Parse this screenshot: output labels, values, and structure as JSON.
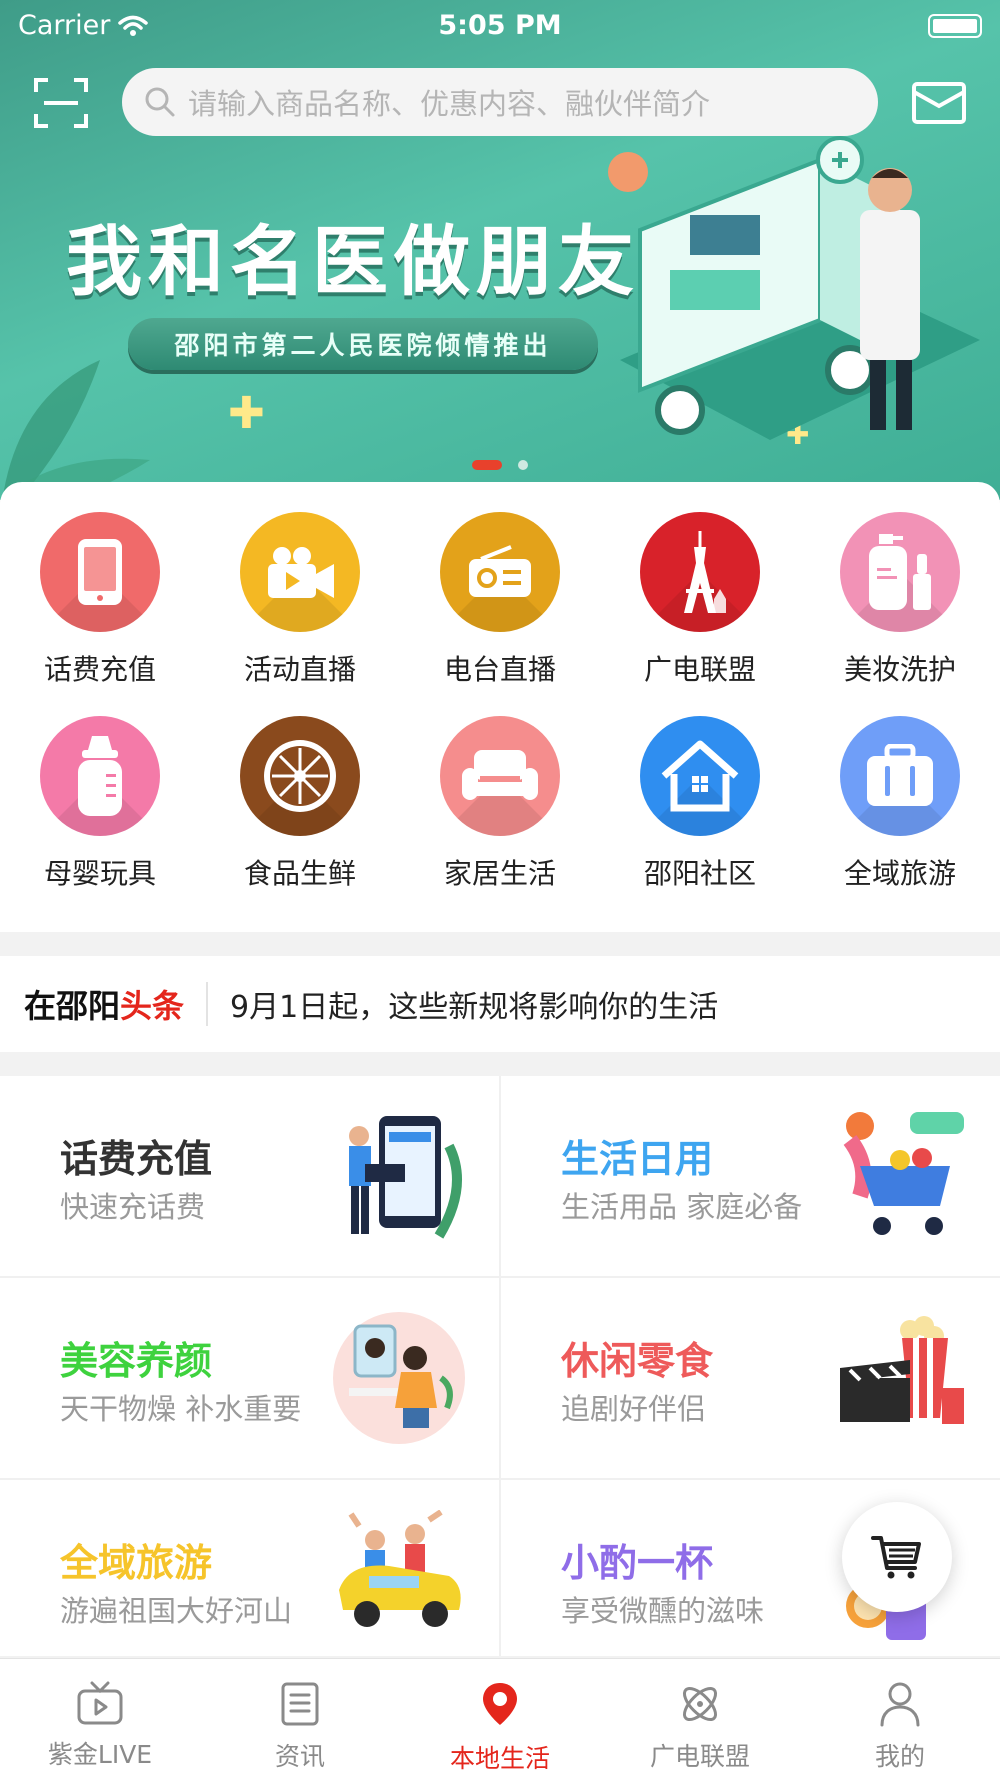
{
  "status_bar": {
    "carrier": "Carrier",
    "time": "5:05 PM"
  },
  "search": {
    "placeholder": "请输入商品名称、优惠内容、融伙伴简介"
  },
  "banner": {
    "title": "我和名医做朋友",
    "subtitle": "邵阳市第二人民医院倾情推出",
    "page_count": 2,
    "active_page": 1
  },
  "categories": [
    {
      "label": "话费充值",
      "icon": "phone-icon",
      "color": "#f06a6a"
    },
    {
      "label": "活动直播",
      "icon": "video-camera-icon",
      "color": "#f4b823"
    },
    {
      "label": "电台直播",
      "icon": "radio-icon",
      "color": "#e3a21a"
    },
    {
      "label": "广电联盟",
      "icon": "tower-icon",
      "color": "#d8222a"
    },
    {
      "label": "美妆洗护",
      "icon": "cosmetics-icon",
      "color": "#f292b6"
    },
    {
      "label": "母婴玩具",
      "icon": "baby-bottle-icon",
      "color": "#f47aa8"
    },
    {
      "label": "食品生鲜",
      "icon": "orange-slice-icon",
      "color": "#8a4a1d"
    },
    {
      "label": "家居生活",
      "icon": "sofa-icon",
      "color": "#f58d8d"
    },
    {
      "label": "邵阳社区",
      "icon": "house-icon",
      "color": "#2f8ef0"
    },
    {
      "label": "全域旅游",
      "icon": "suitcase-icon",
      "color": "#6f9ef8"
    }
  ],
  "headline": {
    "brand_part1": "在邵阳",
    "brand_part2": "头条",
    "text": "9月1日起，这些新规将影响你的生活"
  },
  "tiles": [
    {
      "title": "话费充值",
      "subtitle": "快速充话费",
      "title_color": "#333333",
      "art": "phone-recharge-illustration"
    },
    {
      "title": "生活日用",
      "subtitle": "生活用品 家庭必备",
      "title_color": "#3ea5f0",
      "art": "shopping-cart-illustration"
    },
    {
      "title": "美容养颜",
      "subtitle": "天干物燥 补水重要",
      "title_color": "#3ed23e",
      "art": "makeup-mirror-illustration"
    },
    {
      "title": "休闲零食",
      "subtitle": "追剧好伴侣",
      "title_color": "#ee5a5a",
      "art": "popcorn-illustration"
    },
    {
      "title": "全域旅游",
      "subtitle": "游遍祖国大好河山",
      "title_color": "#f6c42b",
      "art": "travel-car-illustration"
    },
    {
      "title": "小酌一杯",
      "subtitle": "享受微醺的滋味",
      "title_color": "#8f6de8",
      "art": "drink-illustration"
    }
  ],
  "tabbar": [
    {
      "label": "紫金LIVE",
      "icon": "tv-icon",
      "active": false
    },
    {
      "label": "资讯",
      "icon": "document-list-icon",
      "active": false
    },
    {
      "label": "本地生活",
      "icon": "location-pin-icon",
      "active": true
    },
    {
      "label": "广电联盟",
      "icon": "atom-icon",
      "active": false
    },
    {
      "label": "我的",
      "icon": "person-icon",
      "active": false
    }
  ],
  "colors": {
    "accent": "#e4261c",
    "banner": "#4fbca4"
  }
}
